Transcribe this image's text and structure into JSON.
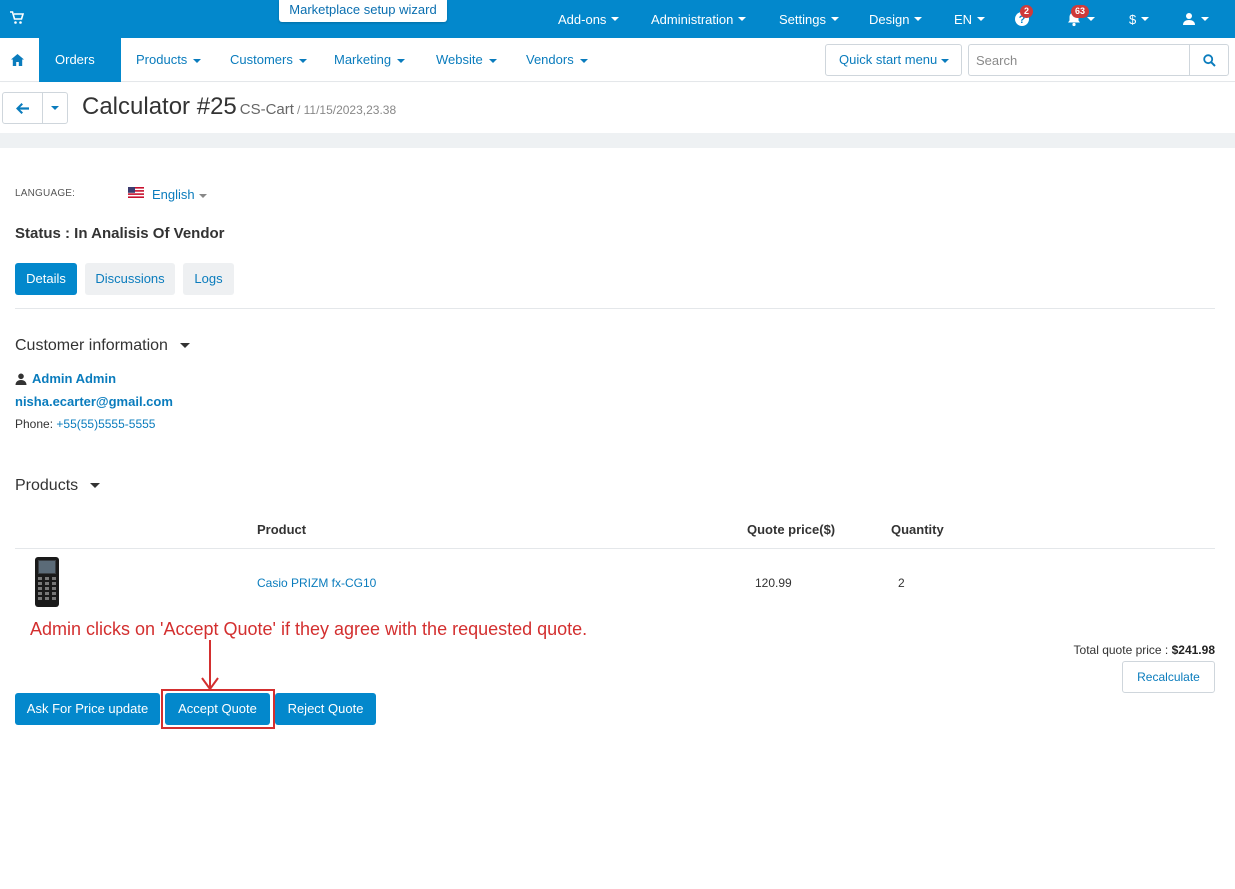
{
  "topbar": {
    "wizard_label": "Marketplace setup wizard",
    "menu": [
      "Add-ons",
      "Administration",
      "Settings",
      "Design",
      "EN"
    ],
    "help_badge": "2",
    "notifications_badge": "63",
    "currency": "$",
    "icons": [
      "cart-icon",
      "help-icon",
      "bell-icon",
      "user-icon"
    ],
    "colors": {
      "primary": "#0388cc",
      "badge": "#cf3a3a"
    }
  },
  "nav": {
    "items": [
      "Orders",
      "Products",
      "Customers",
      "Marketing",
      "Website",
      "Vendors"
    ],
    "active": "Orders",
    "quick_start": "Quick start menu",
    "search_placeholder": "Search"
  },
  "header": {
    "title": "Calculator #25",
    "store": "CS-Cart",
    "date": "/ 11/15/2023,23.38"
  },
  "language": {
    "label": "LANGUAGE:",
    "value": "English"
  },
  "status": "Status : In Analisis Of Vendor",
  "tabs": [
    "Details",
    "Discussions",
    "Logs"
  ],
  "customer": {
    "section_title": "Customer information",
    "name": "Admin Admin",
    "email": "nisha.ecarter@gmail.com",
    "phone_label": "Phone:",
    "phone": "+55(55)5555-5555"
  },
  "products": {
    "section_title": "Products",
    "columns": [
      "Product",
      "Quote price($)",
      "Quantity"
    ],
    "rows": [
      {
        "name": "Casio PRIZM fx-CG10",
        "price": "120.99",
        "qty": "2"
      }
    ],
    "total_label": "Total quote price :",
    "total_value": "$241.98",
    "recalculate": "Recalculate"
  },
  "actions": {
    "ask_price": "Ask For Price update",
    "accept": "Accept Quote",
    "reject": "Reject Quote"
  },
  "annotation": "Admin clicks on 'Accept Quote' if they agree with the requested quote.",
  "annotation_color": "#d32f2f"
}
